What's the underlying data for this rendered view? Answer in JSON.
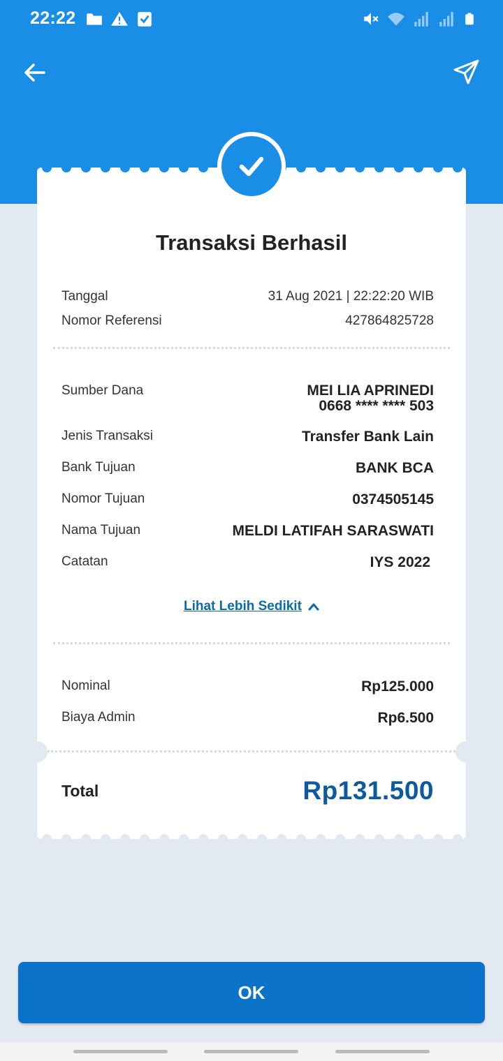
{
  "status_bar": {
    "time": "22:22",
    "left_icons": [
      "folder-icon",
      "warning-icon",
      "checkbox-icon"
    ],
    "right_icons": [
      "mute-icon",
      "wifi-icon",
      "signal-icon",
      "signal-icon",
      "battery-icon"
    ]
  },
  "header": {
    "background_color": "#1a8ee6",
    "back_icon": "arrow-left-icon",
    "share_icon": "send-icon"
  },
  "receipt": {
    "status_icon": "check-icon",
    "title": "Transaksi Berhasil",
    "info": {
      "date_label": "Tanggal",
      "date_value": "31 Aug 2021 | 22:22:20 WIB",
      "ref_label": "Nomor Referensi",
      "ref_value": "427864825728"
    },
    "details": {
      "source_label": "Sumber Dana",
      "source_name": "MEI LIA APRINEDI",
      "source_account": "0668 **** **** 503",
      "type_label": "Jenis Transaksi",
      "type_value": "Transfer Bank Lain",
      "bank_label": "Bank Tujuan",
      "bank_value": "BANK BCA",
      "dest_number_label": "Nomor Tujuan",
      "dest_number_value": "0374505145",
      "dest_name_label": "Nama Tujuan",
      "dest_name_value": "MELDI LATIFAH SARASWATI",
      "note_label": "Catatan",
      "note_value": "IYS 2022"
    },
    "toggle_label": "Lihat Lebih Sedikit",
    "amounts": {
      "nominal_label": "Nominal",
      "nominal_value": "Rp125.000",
      "admin_label": "Biaya Admin",
      "admin_value": "Rp6.500"
    },
    "total_label": "Total",
    "total_value": "Rp131.500"
  },
  "ok_button_label": "OK",
  "colors": {
    "primary": "#1a8ee6",
    "button": "#0a72c8",
    "total_text": "#0b5a9e",
    "link": "#0b6aa8",
    "page_bg": "#e2e9f1"
  }
}
